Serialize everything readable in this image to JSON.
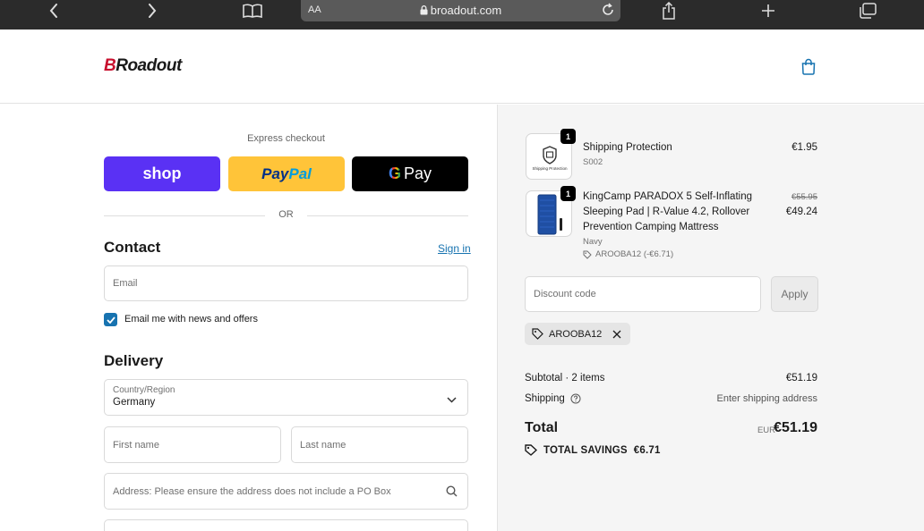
{
  "browser": {
    "text_size_label": "AA",
    "url": "broadout.com",
    "icons": [
      "chevron-left-icon",
      "chevron-right-icon",
      "book-icon",
      "lock-icon",
      "reload-icon",
      "share-icon",
      "plus-icon",
      "tabs-icon"
    ]
  },
  "header": {
    "logo_initial": "B",
    "logo_rest": "Roadout",
    "cart_icon": "shopping-bag-icon"
  },
  "express": {
    "label": "Express checkout",
    "shop_label": "shop",
    "paypal_part1": "Pay",
    "paypal_part2": "Pal",
    "gpay_g": "G",
    "gpay_label": "Pay",
    "or": "OR"
  },
  "contact": {
    "title": "Contact",
    "signin": "Sign in",
    "email_placeholder": "Email",
    "newsletter_label": "Email me with news and offers",
    "newsletter_checked": true
  },
  "delivery": {
    "title": "Delivery",
    "country_label": "Country/Region",
    "country_value": "Germany",
    "first_name_placeholder": "First name",
    "last_name_placeholder": "Last name",
    "address_placeholder": "Address: Please ensure the address does not include a PO Box"
  },
  "order": {
    "items": [
      {
        "qty": "1",
        "name": "Shipping Protection",
        "sku": "S002",
        "price": "€1.95",
        "thumb_caption": "Shipping Protection"
      },
      {
        "qty": "1",
        "name_line1": "KingCamp PARADOX 5 Self-Inflating",
        "name_line2": "Sleeping Pad | R-Value 4.2, Rollover",
        "name_line3": "Prevention Camping Mattress",
        "variant": "Navy",
        "discount_note": "AROOBA12 (-€6.71)",
        "original_price": "€55.95",
        "price": "€49.24"
      }
    ],
    "discount_placeholder": "Discount code",
    "apply_label": "Apply",
    "applied_code": "AROOBA12",
    "subtotal_label": "Subtotal · 2 items",
    "subtotal_value": "€51.19",
    "shipping_label": "Shipping",
    "shipping_value": "Enter shipping address",
    "total_label": "Total",
    "currency": "EUR",
    "total_value": "€51.19",
    "savings_label": "TOTAL SAVINGS",
    "savings_value": "€6.71"
  },
  "colors": {
    "accent": "#1773b0",
    "shop_pay": "#5a31f4",
    "paypal": "#ffc439",
    "gpay": "#000000",
    "logo_red": "#c8102e"
  }
}
